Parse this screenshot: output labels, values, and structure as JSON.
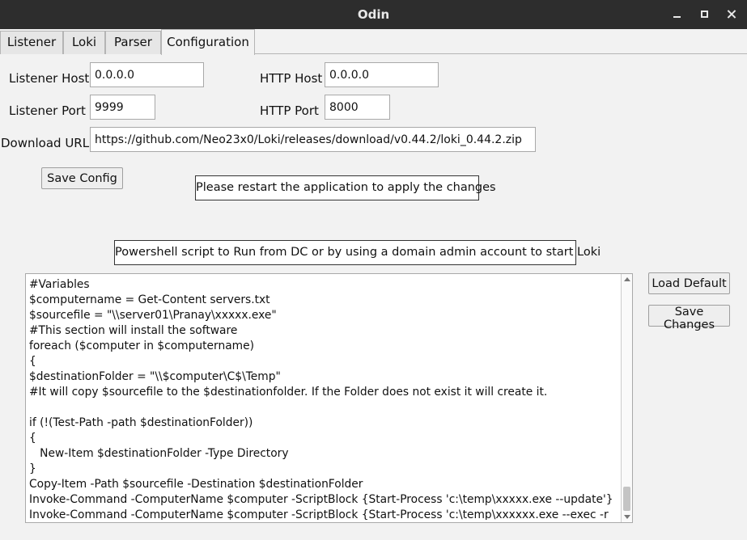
{
  "window": {
    "title": "Odin"
  },
  "tabs": [
    "Listener",
    "Loki",
    "Parser",
    "Configuration"
  ],
  "config": {
    "listener_host_label": "Listener Host",
    "listener_host_value": "0.0.0.0",
    "listener_port_label": "Listener Port",
    "listener_port_value": "9999",
    "http_host_label": "HTTP Host",
    "http_host_value": "0.0.0.0",
    "http_port_label": "HTTP Port",
    "http_port_value": "8000",
    "download_url_label": "Download URL",
    "download_url_value": "https://github.com/Neo23x0/Loki/releases/download/v0.44.2/loki_0.44.2.zip",
    "save_config_label": "Save Config",
    "restart_notice": "Please restart the application to apply the changes"
  },
  "script_panel": {
    "heading": "Powershell script to Run from DC or by using a domain admin account to start Loki",
    "load_default_label": "Load Default",
    "save_changes_label": "Save Changes",
    "lines": [
      "#Variables",
      "$computername = Get-Content servers.txt",
      "$sourcefile = \"\\\\server01\\Pranay\\xxxxx.exe\"",
      "#This section will install the software",
      "foreach ($computer in $computername)",
      "{",
      "$destinationFolder = \"\\\\$computer\\C$\\Temp\"",
      "#It will copy $sourcefile to the $destinationfolder. If the Folder does not exist it will create it.",
      "",
      "if (!(Test-Path -path $destinationFolder))",
      "{",
      "   New-Item $destinationFolder -Type Directory",
      "}",
      "Copy-Item -Path $sourcefile -Destination $destinationFolder",
      "Invoke-Command -ComputerName $computer -ScriptBlock {Start-Process 'c:\\temp\\xxxxx.exe --update'}",
      "Invoke-Command -ComputerName $computer -ScriptBlock {Start-Process 'c:\\temp\\xxxxxx.exe --exec -r"
    ]
  }
}
